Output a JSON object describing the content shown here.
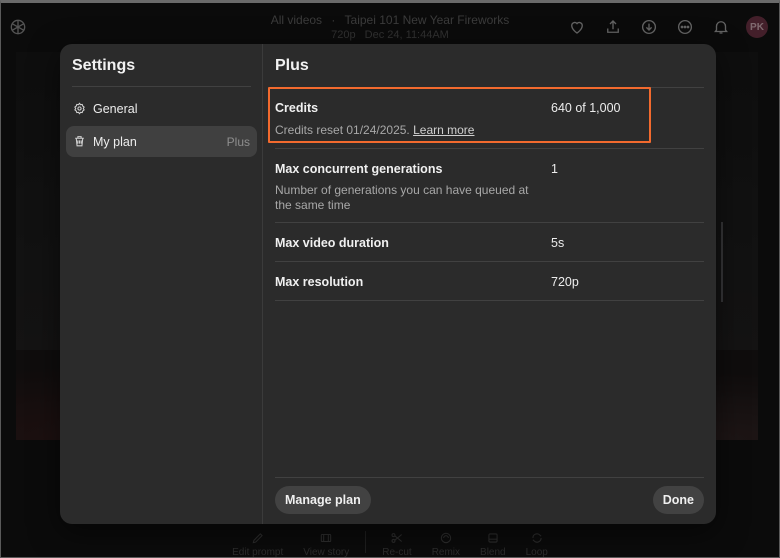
{
  "header": {
    "breadcrumb_root": "All videos",
    "separator": "·",
    "video_title": "Taipei 101 New Year Fireworks",
    "resolution": "720p",
    "timestamp": "Dec 24, 11:44AM",
    "avatar_initials": "PK",
    "icons": [
      "heart-icon",
      "share-icon",
      "download-icon",
      "more-icon",
      "bell-icon"
    ]
  },
  "bottom_toolbar": {
    "items": [
      {
        "label": "Edit prompt",
        "icon": "pencil-icon"
      },
      {
        "label": "View story",
        "icon": "storyboard-icon"
      },
      {
        "label": "Re-cut",
        "icon": "scissors-icon"
      },
      {
        "label": "Remix",
        "icon": "remix-icon"
      },
      {
        "label": "Blend",
        "icon": "blend-icon"
      },
      {
        "label": "Loop",
        "icon": "loop-icon"
      }
    ]
  },
  "settings": {
    "title": "Settings",
    "nav": [
      {
        "label": "General",
        "icon": "gear-icon",
        "badge": ""
      },
      {
        "label": "My plan",
        "icon": "plan-icon",
        "badge": "Plus",
        "active": true
      }
    ]
  },
  "plan": {
    "title": "Plus",
    "credits": {
      "label": "Credits",
      "value": "640 of 1,000",
      "desc_prefix": "Credits reset 01/24/2025.",
      "learn_more": "Learn more"
    },
    "concurrent": {
      "label": "Max concurrent generations",
      "value": "1",
      "desc": "Number of generations you can have queued at the same time"
    },
    "duration": {
      "label": "Max video duration",
      "value": "5s"
    },
    "resolution": {
      "label": "Max resolution",
      "value": "720p"
    },
    "manage_label": "Manage plan",
    "done_label": "Done"
  },
  "colors": {
    "highlight": "#f26a2e",
    "modal_bg": "#2b2b2b",
    "button_bg": "#424242"
  }
}
